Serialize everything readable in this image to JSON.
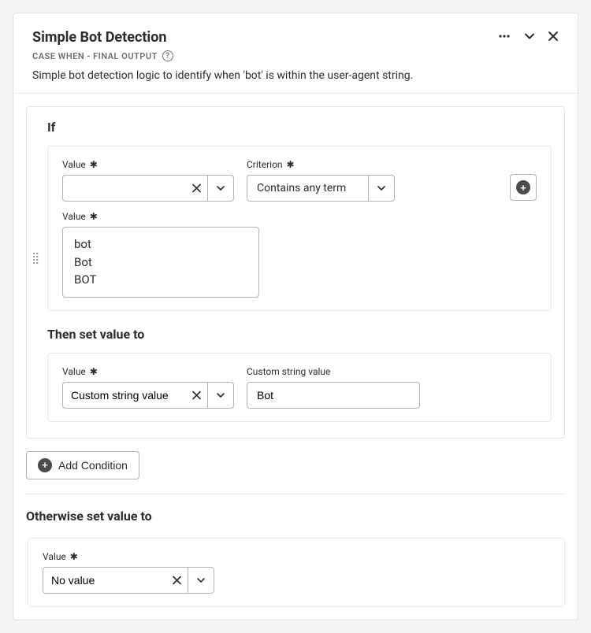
{
  "header": {
    "title": "Simple Bot Detection",
    "subtitle": "CASE WHEN - FINAL OUTPUT",
    "description": "Simple bot detection logic to identify when 'bot' is within the user-agent string."
  },
  "if_section": {
    "heading": "If",
    "value_label": "Value",
    "criterion_label": "Criterion",
    "value_input": "",
    "criterion_selected": "Contains any term",
    "terms_label": "Value",
    "terms_value": "bot\nBot\nBOT"
  },
  "then_section": {
    "heading": "Then set value to",
    "value_label": "Value",
    "value_selected": "Custom string value",
    "custom_label": "Custom string value",
    "custom_value": "Bot"
  },
  "add_condition_label": "Add Condition",
  "otherwise_section": {
    "heading": "Otherwise set value to",
    "value_label": "Value",
    "value_selected": "No value"
  }
}
